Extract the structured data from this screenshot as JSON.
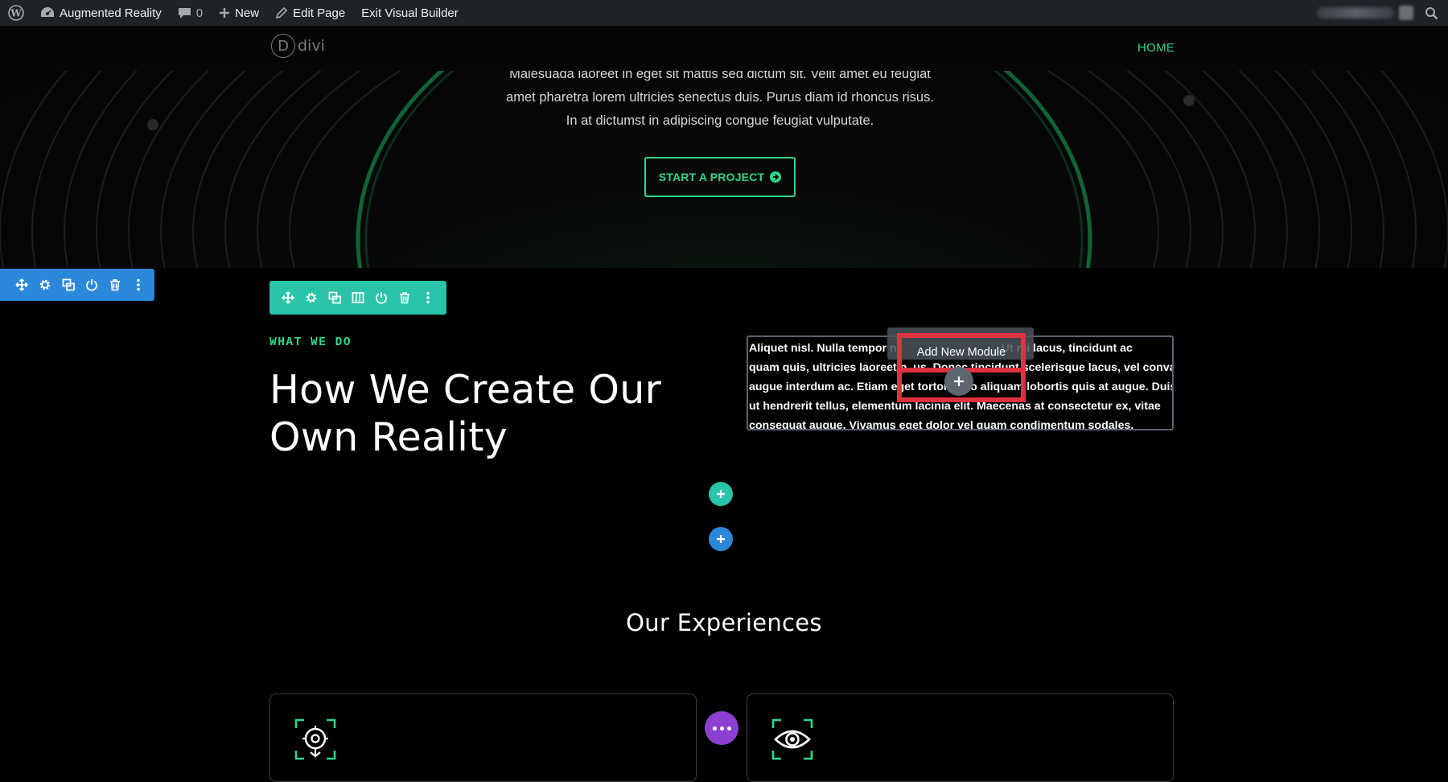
{
  "admin_bar": {
    "site_name": "Augmented Reality",
    "comments_count": "0",
    "new_label": "New",
    "edit_label": "Edit Page",
    "exit_label": "Exit Visual Builder"
  },
  "header": {
    "logo_letter": "D",
    "logo_word": "divi",
    "nav_home": "HOME"
  },
  "hero": {
    "text_lines": [
      "Malesuada laoreet in eget sit mattis sed dictum sit. Velit amet eu feugiat",
      "amet pharetra lorem ultricies senectus duis. Purus diam id rhoncus risus.",
      "In at dictumst in adipiscing congue feugiat vulputate."
    ],
    "cta_label": "START A PROJECT"
  },
  "section": {
    "eyebrow": "WHAT WE DO",
    "headline_line1": "How We Create Our",
    "headline_line2": "Own Reality",
    "body_lines": [
      "Aliquet nisl. Nulla tempor n                                 Ut mi lacus, tincidunt ac",
      "quam quis, ultricies laoreet p  us. Donec tincidunt scelerisque lacus, vel convallis",
      "augue interdum ac. Etiam eget tortor a    o aliquam lobortis quis at augue. Duis",
      "ut hendrerit tellus, elementum lacinia elit. Maecenas at consectetur ex, vitae",
      "consequat augue. Vivamus eget dolor vel quam condimentum sodales."
    ],
    "add_module_tooltip": "Add New Module"
  },
  "experiences": {
    "title": "Our Experiences"
  },
  "colors": {
    "accent_green": "#2bd98a",
    "row_toolbar": "#29c4a9",
    "section_toolbar": "#2b87da",
    "highlight_red": "#e2313e",
    "more_purple": "#8c3fd1"
  },
  "icons": {
    "wordpress": "wordpress-icon",
    "dashboard": "dashboard-icon",
    "comment": "comment-icon",
    "plus": "plus-icon",
    "pencil": "pencil-icon",
    "search": "search-icon",
    "move": "move-icon",
    "gear": "gear-icon",
    "duplicate": "duplicate-icon",
    "columns": "columns-icon",
    "power": "power-icon",
    "trash": "trash-icon",
    "kebab": "kebab-icon",
    "location_target": "location-target-icon",
    "eye": "eye-icon"
  }
}
